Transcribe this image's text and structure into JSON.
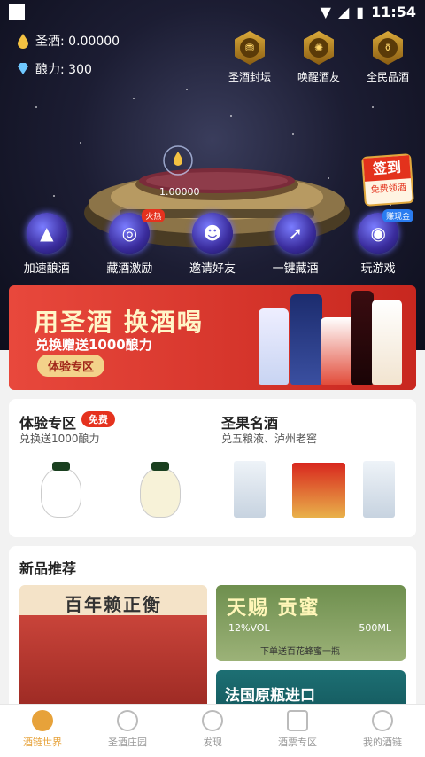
{
  "status": {
    "time": "11:54"
  },
  "stats": {
    "wine_label": "圣酒: 0.00000",
    "power_label": "酿力: 300"
  },
  "top_icons": [
    {
      "label": "圣酒封坛",
      "icon": "jar-seal-icon"
    },
    {
      "label": "唤醒酒友",
      "icon": "wake-friend-icon"
    },
    {
      "label": "全民品酒",
      "icon": "taste-icon"
    }
  ],
  "vat": {
    "value": "1.00000"
  },
  "signin": {
    "title": "签到",
    "sub": "免费领酒"
  },
  "actions": [
    {
      "label": "加速酿酒",
      "badge": ""
    },
    {
      "label": "藏酒激励",
      "badge": "火热"
    },
    {
      "label": "邀请好友",
      "badge": ""
    },
    {
      "label": "一键藏酒",
      "badge": ""
    },
    {
      "label": "玩游戏",
      "badge": "赚现金"
    }
  ],
  "banner": {
    "headline": "用圣酒 换酒喝",
    "sub": "兑换赠送1000酿力",
    "button": "体验专区"
  },
  "experience": {
    "title": "体验专区",
    "tag": "免费",
    "sub": "兑换送1000酿力"
  },
  "shengguo": {
    "title": "圣果名酒",
    "sub": "兑五粮液、泸州老窖"
  },
  "recommend": {
    "title": "新品推荐",
    "tile1": "百年赖正衡",
    "tile2_title": "天赐  贡蜜",
    "tile2_left": "12%VOL",
    "tile2_right": "500ML",
    "tile2_note": "下单送百花蜂蜜一瓶",
    "tile3": "法国原瓶进口"
  },
  "tabs": [
    {
      "label": "酒链世界",
      "active": true
    },
    {
      "label": "圣酒庄园",
      "active": false
    },
    {
      "label": "发现",
      "active": false
    },
    {
      "label": "酒票专区",
      "active": false
    },
    {
      "label": "我的酒链",
      "active": false
    }
  ],
  "colors": {
    "accent": "#e7a23a",
    "red": "#e5321e"
  }
}
